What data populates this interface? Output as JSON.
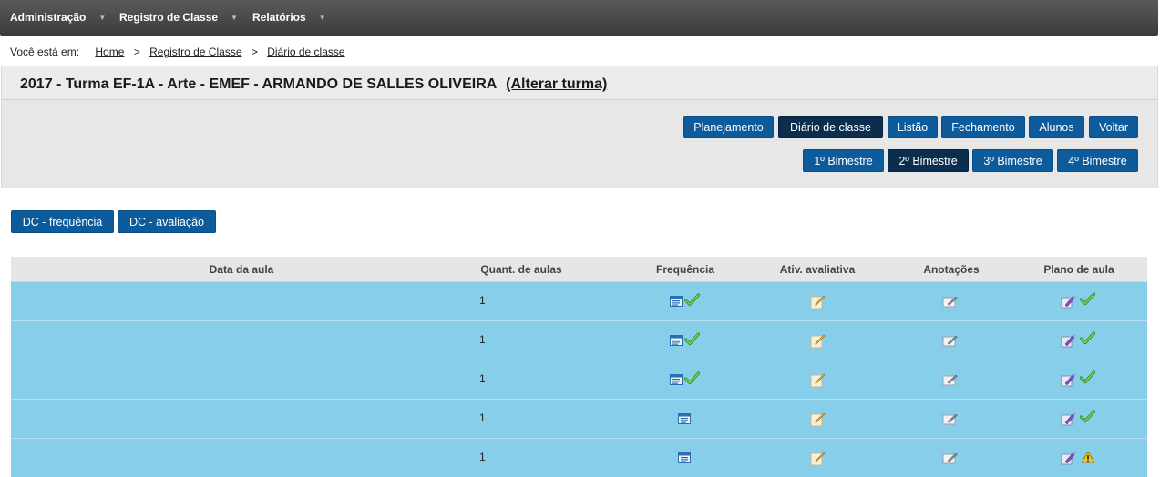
{
  "nav": {
    "items": [
      {
        "label": "Administração"
      },
      {
        "label": "Registro de Classe"
      },
      {
        "label": "Relatórios"
      }
    ],
    "caret": "▼"
  },
  "breadcrumb": {
    "prefix": "Você está em:",
    "items": [
      "Home",
      "Registro de Classe",
      "Diário de classe"
    ],
    "sep": ">"
  },
  "header": {
    "title": "2017 - Turma EF-1A - Arte - EMEF - ARMANDO DE SALLES OLIVEIRA",
    "change_link": "(Alterar turma)"
  },
  "toolbar": {
    "main_buttons": [
      "Planejamento",
      "Diário de classe",
      "Listão",
      "Fechamento",
      "Alunos",
      "Voltar"
    ],
    "active_main": "Diário de classe",
    "bimestres": [
      "1º Bimestre",
      "2º Bimestre",
      "3º Bimestre",
      "4º Bimestre"
    ],
    "active_bimestre": "2º Bimestre"
  },
  "dc_buttons": [
    "DC - frequência",
    "DC - avaliação"
  ],
  "table": {
    "columns": [
      "Data da aula",
      "Quant. de aulas",
      "Frequência",
      "Ativ. avaliativa",
      "Anotações",
      "Plano de aula"
    ],
    "rows": [
      {
        "qty": "1",
        "freq_check": true,
        "plan_status": "check"
      },
      {
        "qty": "1",
        "freq_check": true,
        "plan_status": "check"
      },
      {
        "qty": "1",
        "freq_check": true,
        "plan_status": "check"
      },
      {
        "qty": "1",
        "freq_check": false,
        "plan_status": "check"
      },
      {
        "qty": "1",
        "freq_check": false,
        "plan_status": "warning"
      }
    ]
  },
  "colors": {
    "row_bg": "#87ceeb",
    "button": "#0e5b9c",
    "button_active": "#0b2e4f",
    "nav_bg": "#444444"
  }
}
